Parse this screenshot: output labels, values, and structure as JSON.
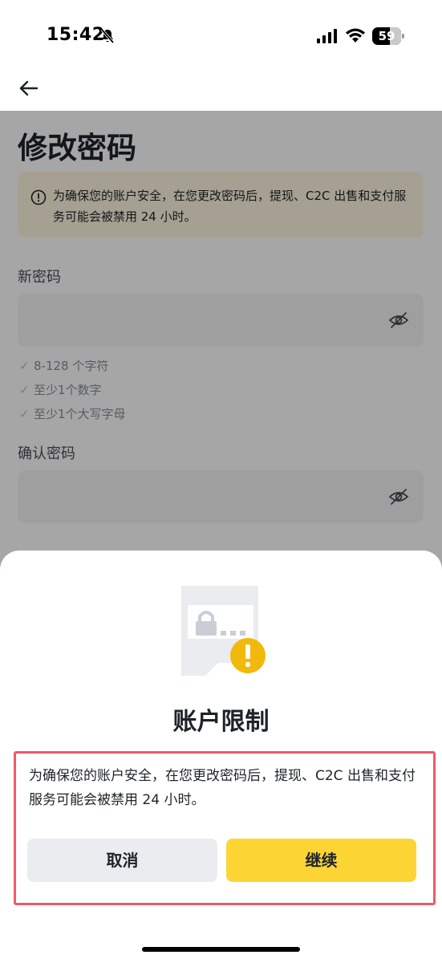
{
  "status_bar": {
    "time": "15:42",
    "battery": "59"
  },
  "page": {
    "title": "修改密码",
    "warning": "为确保您的账户安全，在您更改密码后，提现、C2C 出售和支付服务可能会被禁用 24 小时。",
    "new_password_label": "新密码",
    "rules": [
      "8-128 个字符",
      "至少1个数字",
      "至少1个大写字母"
    ],
    "confirm_password_label": "确认密码"
  },
  "sheet": {
    "title": "账户限制",
    "message": "为确保您的账户安全，在您更改密码后，提现、C2C 出售和支付服务可能会被禁用 24 小时。",
    "cancel_label": "取消",
    "continue_label": "继续"
  },
  "icons": {
    "back": "arrow-left-icon",
    "bell": "bell-slash-icon",
    "eye": "eye-off-icon",
    "warning": "info-circle-icon"
  },
  "colors": {
    "accent": "#fcd535",
    "warning_bg": "#fdf6df",
    "highlight_border": "#ee5a68",
    "alert_badge": "#f0b90b"
  }
}
